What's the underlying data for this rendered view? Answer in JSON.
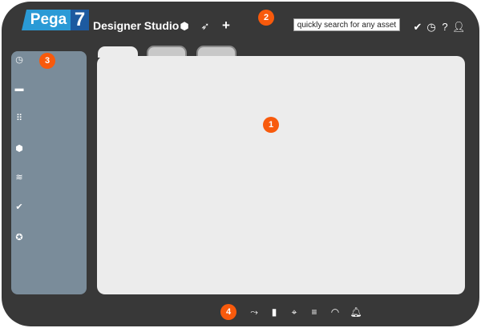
{
  "header": {
    "logo_text": "Pega",
    "logo_version": "7",
    "title": "Designer Studio",
    "search_placeholder": "quickly search for any asset",
    "left_icons": [
      "cube-icon",
      "rocket-icon",
      "plus-icon"
    ],
    "right_icons": [
      "check-icon",
      "clock-icon",
      "help-icon",
      "user-icon"
    ]
  },
  "sidebar": {
    "icons": [
      "clock-icon",
      "briefcase-icon",
      "grid-icon",
      "cube-icon",
      "layers-icon",
      "check-icon",
      "star-icon"
    ]
  },
  "tabs": [
    {
      "active": true
    },
    {
      "active": false
    },
    {
      "active": false
    }
  ],
  "footer": {
    "icons": [
      "flow-icon",
      "clipboard-icon",
      "crosshair-icon",
      "list-icon",
      "gauge-icon",
      "alarm-icon"
    ]
  },
  "badges": [
    "1",
    "2",
    "3",
    "4"
  ],
  "colors": {
    "frame": "#383838",
    "sidebar": "#7a8c9a",
    "badge": "#f85a0c",
    "logo": "#2a9ad6"
  }
}
